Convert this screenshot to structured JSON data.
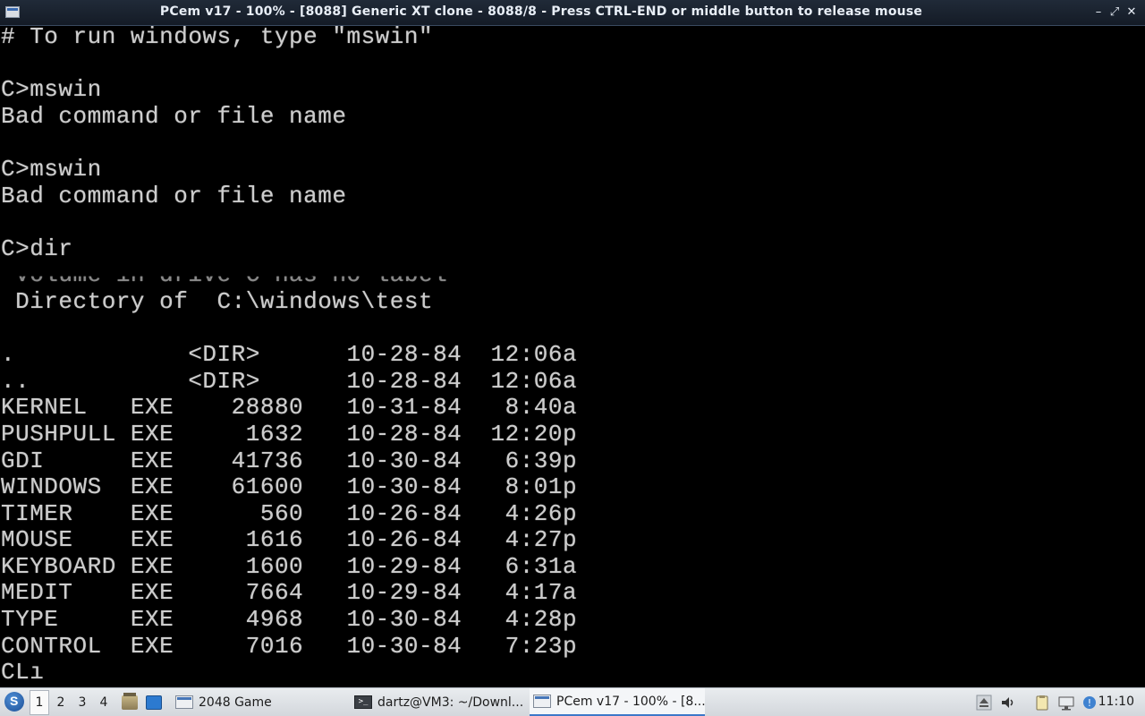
{
  "window": {
    "title": "PCem v17 - 100% - [8088] Generic XT clone - 8088/8 - Press CTRL-END or middle button to release mouse",
    "buttons": {
      "minimize": "–",
      "maximize": "⤢",
      "close": "✕"
    }
  },
  "terminal": {
    "lines": [
      "# To run windows, type \"mswin\"",
      "",
      "C>mswin",
      "Bad command or file name",
      "",
      "C>mswin",
      "Bad command or file name",
      "",
      "C>dir",
      " Volume in drive C has no label",
      " Directory of  C:\\windows\\test",
      "",
      ".            <DIR>      10-28-84  12:06a",
      "..           <DIR>      10-28-84  12:06a",
      "KERNEL   EXE    28880   10-31-84   8:40a",
      "PUSHPULL EXE     1632   10-28-84  12:20p",
      "GDI      EXE    41736   10-30-84   6:39p",
      "WINDOWS  EXE    61600   10-30-84   8:01p",
      "TIMER    EXE      560   10-26-84   4:26p",
      "MOUSE    EXE     1616   10-26-84   4:27p",
      "KEYBOARD EXE     1600   10-29-84   6:31a",
      "MEDIT    EXE     7664   10-29-84   4:17a",
      "TYPE     EXE     4968   10-30-84   4:28p",
      "CONTROL  EXE     7016   10-30-84   7:23p",
      "CLı"
    ]
  },
  "taskbar": {
    "desktops": [
      "1",
      "2",
      "3",
      "4"
    ],
    "active_desktop": "1",
    "tasks": [
      {
        "label": "2048 Game",
        "icon": "window-icon"
      },
      {
        "label": "dartz@VM3: ~/Downl...",
        "icon": "terminal-icon"
      },
      {
        "label": "PCem v17 - 100% - [8...",
        "icon": "window-icon"
      }
    ],
    "clock": "11:10"
  }
}
